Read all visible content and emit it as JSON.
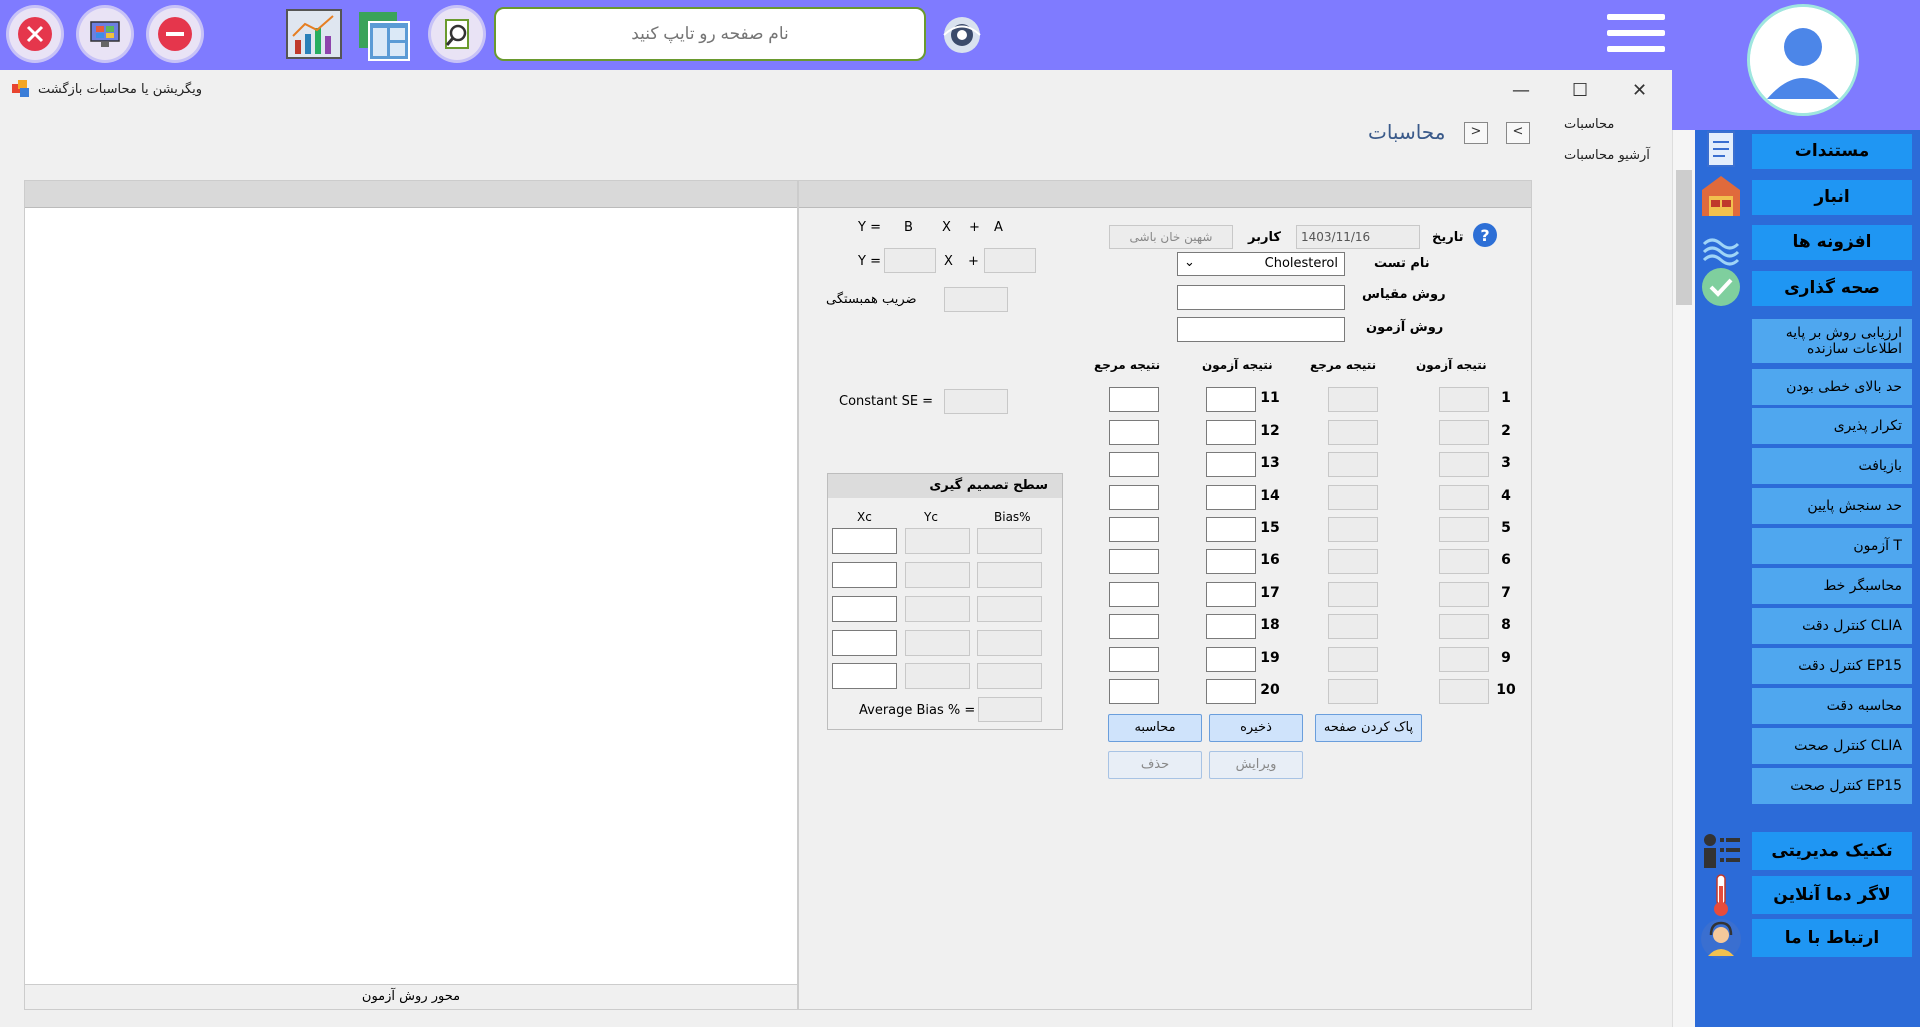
{
  "topbar": {
    "search_placeholder": "نام صفحه رو تایپ کنید",
    "icons": [
      "close-icon",
      "monitor-icon",
      "minus-icon",
      "chart-icon",
      "windows-icon",
      "search-doc-icon",
      "eye-icon"
    ]
  },
  "window": {
    "title": "ویگریشن یا  محاسبات بازگشت",
    "page_title": "محاسبات",
    "nav_back": "<",
    "nav_forward": ">"
  },
  "side_links": [
    "محاسبات",
    "آرشیو محاسبات"
  ],
  "sidebar": {
    "big_buttons_top": [
      "مستندات",
      "انبار",
      "افزونه ها",
      "صحه گذاری"
    ],
    "sub_buttons": [
      "ارزیابی روش بر پایه اطلاعات سازنده",
      "حد بالای خطی بودن",
      "تکرار پذیری",
      "بازیافت",
      "حد سنجش پایین",
      "آزمون T",
      "محاسبگر خط",
      "کنترل دقت CLIA",
      "کنترل دقت EP15",
      "محاسبه دقت",
      "کنترل صحت CLIA",
      "کنترل صحت EP15"
    ],
    "big_buttons_bottom": [
      "تکنیک مدیریتی",
      "لاگر دما آنلاین",
      "ارتباط با ما"
    ]
  },
  "form": {
    "date_label": "تاریخ",
    "date_value": "1403/11/16",
    "user_label": "کاربر",
    "user_value": "شهین خان باشی",
    "test_name_label": "نام تست",
    "test_name_value": "Cholesterol",
    "measure_method_label": "روش مقیاس",
    "test_method_label": "روش آزمون",
    "col_test_result": "نتیجه آزمون",
    "col_ref_result": "نتیجه مرجع",
    "rows_left": [
      "1",
      "2",
      "3",
      "4",
      "5",
      "6",
      "7",
      "8",
      "9",
      "10"
    ],
    "rows_right": [
      "11",
      "12",
      "13",
      "14",
      "15",
      "16",
      "17",
      "18",
      "19",
      "20"
    ],
    "btn_clear": "پاک کردن صفحه",
    "btn_save": "ذخیره",
    "btn_calc": "محاسبه",
    "btn_edit": "ویرایش",
    "btn_delete": "حذف"
  },
  "equation": {
    "line1": [
      "Y =",
      "B",
      "X",
      "+",
      "A"
    ],
    "line2_y": "Y =",
    "line2_x": "X",
    "line2_plus": "+",
    "corr_label": "ضریب همبستگی",
    "constant_se": "Constant SE ="
  },
  "decision": {
    "title": "سطح تصمیم گیری",
    "cols": [
      "Xc",
      "Yc",
      "Bias%"
    ],
    "avg_bias": "Average Bias % ="
  },
  "chart": {
    "axis_label": "محور روش آزمون"
  }
}
